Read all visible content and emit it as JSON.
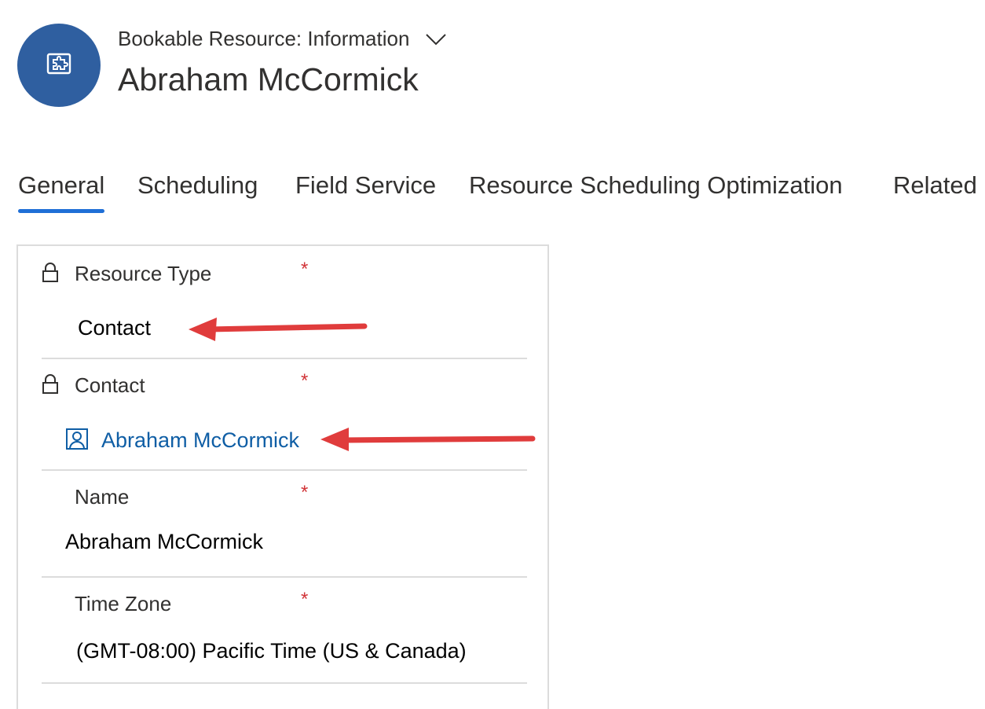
{
  "header": {
    "form_name": "Bookable Resource: Information",
    "record_title": "Abraham McCormick",
    "avatar_icon": "puzzle-icon",
    "avatar_color": "#2f5fa0"
  },
  "tabs": [
    {
      "label": "General",
      "active": true
    },
    {
      "label": "Scheduling",
      "active": false
    },
    {
      "label": "Field Service",
      "active": false
    },
    {
      "label": "Resource Scheduling Optimization",
      "active": false
    },
    {
      "label": "Related",
      "active": false
    }
  ],
  "fields": [
    {
      "label": "Resource Type",
      "value": "Contact",
      "required": true,
      "locked": true
    },
    {
      "label": "Contact",
      "value": "Abraham McCormick",
      "required": true,
      "locked": true,
      "lookup_icon": "contact-icon"
    },
    {
      "label": "Name",
      "value": "Abraham McCormick",
      "required": true,
      "locked": false
    },
    {
      "label": "Time Zone",
      "value": "(GMT-08:00) Pacific Time (US & Canada)",
      "required": true,
      "locked": false
    }
  ],
  "required_marker": "*",
  "colors": {
    "accent": "#1f6fd6",
    "link": "#0f5ea5",
    "required": "#d13438",
    "annotation_arrow": "#e03c3c"
  }
}
